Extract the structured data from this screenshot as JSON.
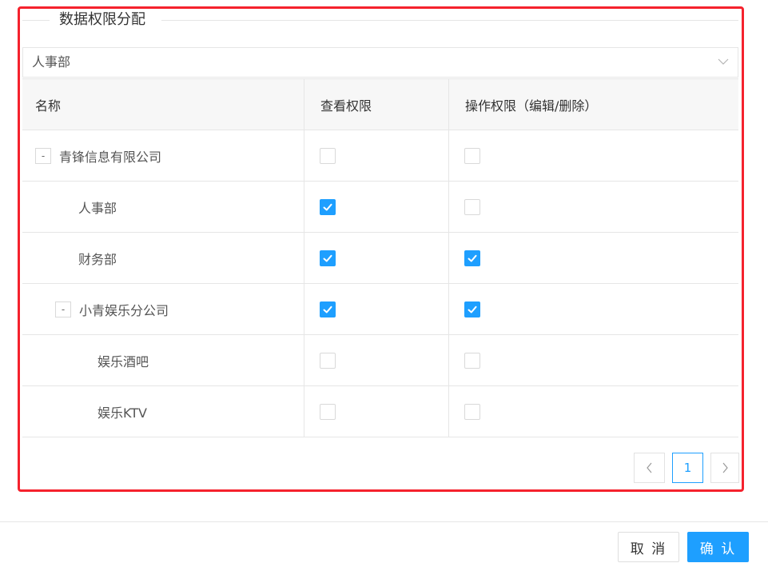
{
  "fieldset": {
    "legend": "数据权限分配"
  },
  "select": {
    "value": "人事部",
    "arrow_icon": "chevron-down-icon"
  },
  "table": {
    "headers": [
      "名称",
      "查看权限",
      "操作权限（编辑/删除）"
    ],
    "rows": [
      {
        "name": "青锋信息有限公司",
        "level": 0,
        "toggle": "-",
        "view": false,
        "operate": false
      },
      {
        "name": "人事部",
        "level": 1,
        "toggle": "",
        "view": true,
        "operate": false
      },
      {
        "name": "财务部",
        "level": 1,
        "toggle": "",
        "view": true,
        "operate": true
      },
      {
        "name": "小青娱乐分公司",
        "level": 1,
        "toggle": "-",
        "view": true,
        "operate": true
      },
      {
        "name": "娱乐酒吧",
        "level": 2,
        "toggle": "",
        "view": false,
        "operate": false
      },
      {
        "name": "娱乐KTV",
        "level": 2,
        "toggle": "",
        "view": false,
        "operate": false
      }
    ]
  },
  "pagination": {
    "prev_icon": "chevron-left-icon",
    "current_page": "1",
    "next_icon": "chevron-right-icon"
  },
  "footer": {
    "cancel_label": "取 消",
    "confirm_label": "确 认"
  },
  "colors": {
    "accent": "#1e9fff",
    "highlight": "#f5222d",
    "border": "#e6e6e6",
    "header_bg": "#f7f7f7"
  }
}
